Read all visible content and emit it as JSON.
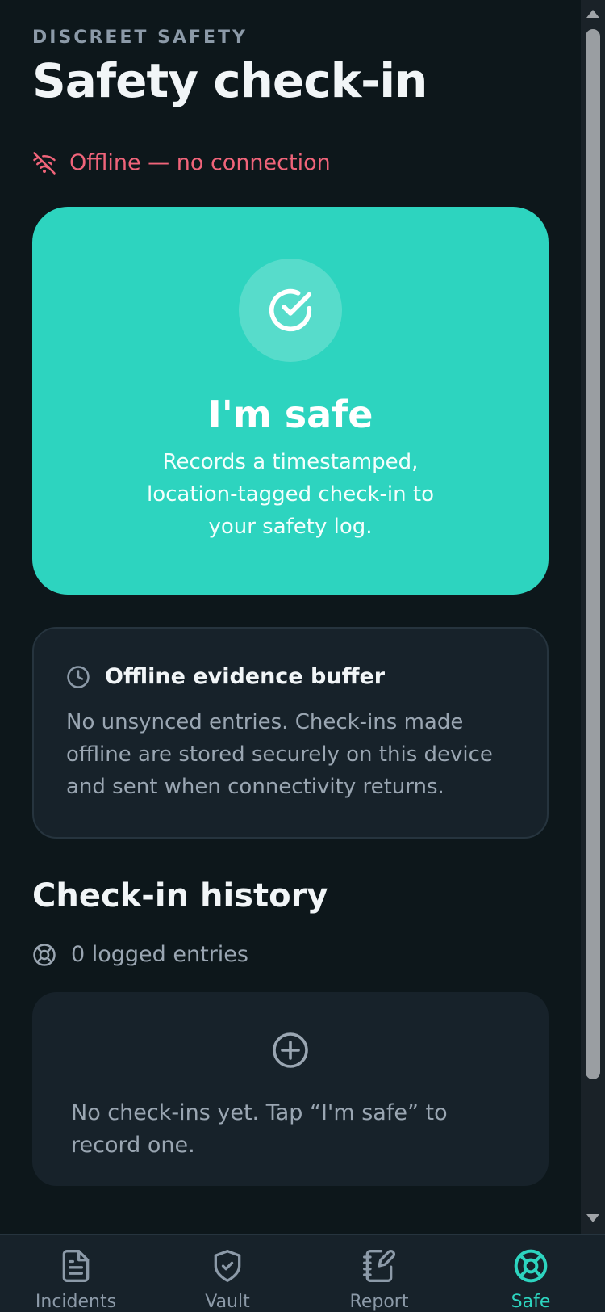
{
  "header": {
    "eyebrow": "DISCREET SAFETY",
    "title": "Safety check-in"
  },
  "status": {
    "offline_text": "Offline — no connection",
    "color": "#f0647a"
  },
  "safe_card": {
    "title": "I'm safe",
    "description": "Records a timestamped, location-tagged check-in to your safety log.",
    "color": "#2dd4bf"
  },
  "buffer": {
    "title": "Offline evidence buffer",
    "body": "No unsynced entries. Check-ins made offline are stored securely on this device and sent when connectivity returns."
  },
  "history": {
    "title": "Check-in history",
    "count_text": "0 logged entries",
    "empty_text": "No check-ins yet. Tap “I'm safe” to record one."
  },
  "nav": {
    "items": [
      {
        "label": "Incidents",
        "icon": "document-icon"
      },
      {
        "label": "Vault",
        "icon": "shield-check-icon"
      },
      {
        "label": "Report",
        "icon": "notebook-pen-icon"
      },
      {
        "label": "Safe",
        "icon": "lifebuoy-icon",
        "active": true
      }
    ],
    "active_color": "#2dd4bf"
  }
}
